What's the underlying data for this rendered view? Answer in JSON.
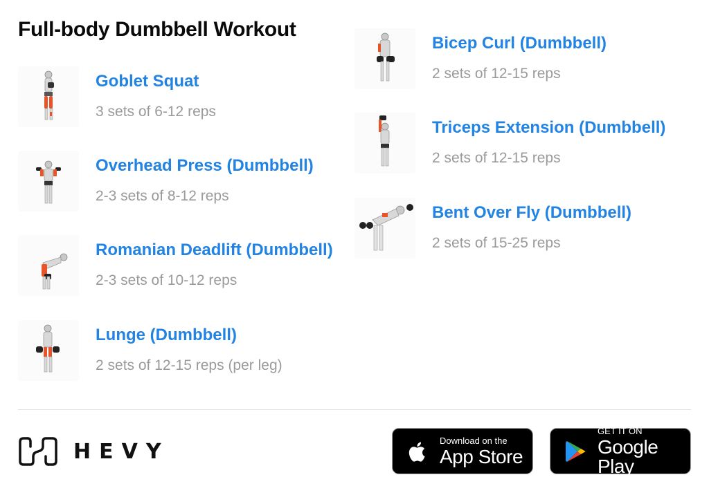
{
  "page": {
    "title": "Full-body Dumbbell Workout"
  },
  "exercises": [
    {
      "name": "Goblet Squat",
      "sets": "3 sets of 6-12 reps",
      "icon": "goblet-squat-figure"
    },
    {
      "name": "Overhead Press (Dumbbell)",
      "sets": "2-3 sets of 8-12 reps",
      "icon": "overhead-press-figure"
    },
    {
      "name": "Romanian Deadlift (Dumbbell)",
      "sets": "2-3 sets of 10-12 reps",
      "icon": "romanian-deadlift-figure"
    },
    {
      "name": "Lunge (Dumbbell)",
      "sets": "2 sets of 12-15 reps (per leg)",
      "icon": "lunge-figure"
    },
    {
      "name": "Bicep Curl (Dumbbell)",
      "sets": "2 sets of 12-15 reps",
      "icon": "bicep-curl-figure"
    },
    {
      "name": "Triceps Extension (Dumbbell)",
      "sets": "2 sets of 12-15 reps",
      "icon": "triceps-extension-figure"
    },
    {
      "name": "Bent Over Fly (Dumbbell)",
      "sets": "2 sets of 15-25 reps",
      "icon": "bent-over-fly-figure"
    }
  ],
  "footer": {
    "brand": "HEVY",
    "app_store": {
      "small": "Download on the",
      "big": "App Store"
    },
    "google_play": {
      "small": "GET IT ON",
      "big": "Google Play"
    }
  },
  "colors": {
    "link": "#2383e2",
    "muted": "#9a9a9a",
    "muscle": "#e8542a"
  }
}
